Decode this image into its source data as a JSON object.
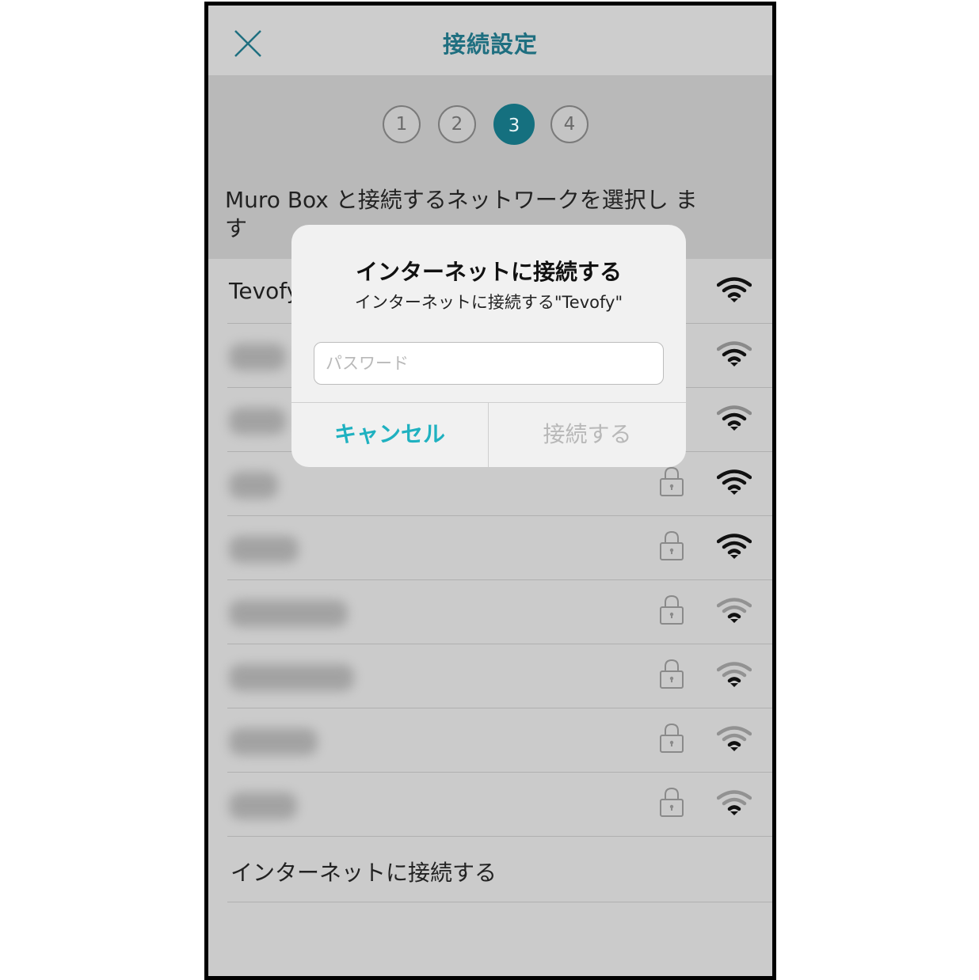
{
  "nav": {
    "title": "接続設定"
  },
  "steps": [
    {
      "label": "1",
      "active": false
    },
    {
      "label": "2",
      "active": false
    },
    {
      "label": "3",
      "active": true
    },
    {
      "label": "4",
      "active": false
    }
  ],
  "instruction": "Muro Box と接続するネットワークを選択し ます",
  "networks": [
    {
      "name": "Tevofy",
      "locked": false,
      "signal": "strong"
    },
    {
      "name": "",
      "locked": false,
      "signal": "strong",
      "blurred": true
    },
    {
      "name": "",
      "locked": false,
      "signal": "strong",
      "blurred": true
    },
    {
      "name": "",
      "locked": true,
      "signal": "strong",
      "blurred": true
    },
    {
      "name": "",
      "locked": true,
      "signal": "strong",
      "blurred": true
    },
    {
      "name": "",
      "locked": true,
      "signal": "weak",
      "blurred": true
    },
    {
      "name": "",
      "locked": true,
      "signal": "weak",
      "blurred": true
    },
    {
      "name": "",
      "locked": true,
      "signal": "weak",
      "blurred": true
    },
    {
      "name": "",
      "locked": true,
      "signal": "weak",
      "blurred": true
    }
  ],
  "footer": {
    "label": "インターネットに接続する"
  },
  "dialog": {
    "title": "インターネットに接続する",
    "message": "インターネットに接続する\"Tevofy\"",
    "password_placeholder": "パスワード",
    "password_value": "",
    "cancel_label": "キャンセル",
    "connect_label": "接続する"
  },
  "colors": {
    "accent": "#15707f",
    "title": "#1f6f80",
    "cancel": "#1fb1c0",
    "disabled": "#b8b8b8",
    "background": "#cbcbcb"
  }
}
